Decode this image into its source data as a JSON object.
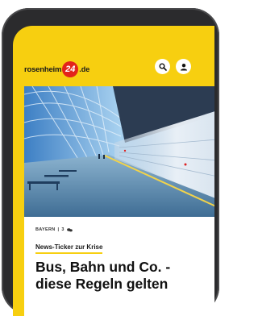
{
  "header": {
    "logo_text": "rosenheim",
    "logo_number": "24",
    "logo_tld": ".de",
    "search_icon": "search-icon",
    "user_icon": "user-icon"
  },
  "article": {
    "hero_image": "train-station-photo",
    "category": "BAYERN",
    "separator": "|",
    "count": "3",
    "kicker": "News-Ticker zur Krise",
    "headline_line1": "Bus, Bahn und Co. -",
    "headline_line2": "diese Regeln gelten"
  },
  "colors": {
    "brand_yellow": "#f7cf10",
    "logo_red": "#e3241b"
  }
}
